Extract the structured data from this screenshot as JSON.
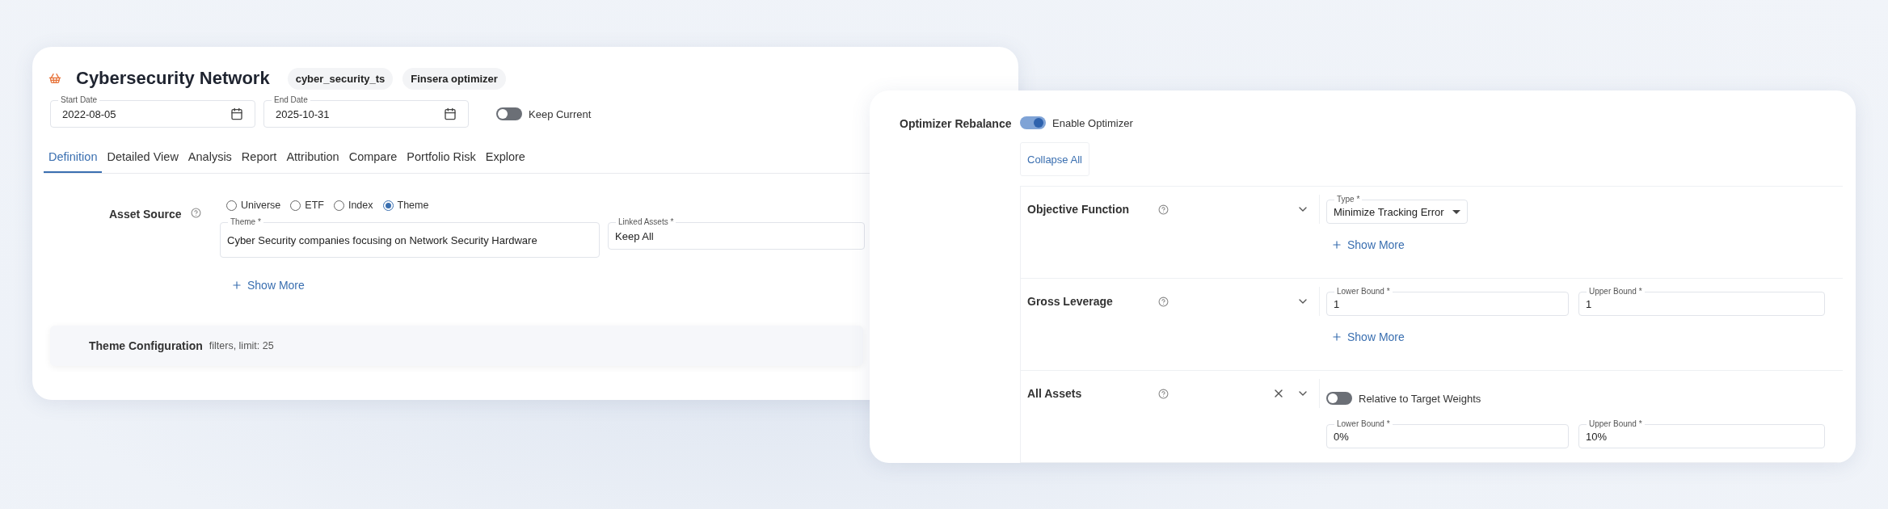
{
  "portfolio": {
    "title": "Cybersecurity Network",
    "tags": [
      "cyber_security_ts",
      "Finsera optimizer"
    ],
    "dates": [
      {
        "label": "Start Date",
        "value": "2022-08-05"
      },
      {
        "label": "End Date",
        "value": "2025-10-31"
      }
    ],
    "keep_current": {
      "label": "Keep Current",
      "on": false
    }
  },
  "tabs": [
    {
      "label": "Definition",
      "selected": true
    },
    {
      "label": "Detailed View",
      "selected": false
    },
    {
      "label": "Analysis",
      "selected": false
    },
    {
      "label": "Report",
      "selected": false
    },
    {
      "label": "Attribution",
      "selected": false
    },
    {
      "label": "Compare",
      "selected": false
    },
    {
      "label": "Portfolio Risk",
      "selected": false
    },
    {
      "label": "Explore",
      "selected": false
    }
  ],
  "asset_source": {
    "label": "Asset Source",
    "options": [
      {
        "label": "Universe",
        "selected": false
      },
      {
        "label": "ETF",
        "selected": false
      },
      {
        "label": "Index",
        "selected": false
      },
      {
        "label": "Theme",
        "selected": true
      }
    ],
    "theme_field": {
      "label": "Theme *",
      "value": "Cyber Security companies focusing on Network Security Hardware"
    },
    "linked_assets": {
      "label": "Linked Assets *",
      "value": "Keep All"
    },
    "show_more": "Show More"
  },
  "theme_configuration": {
    "title": "Theme Configuration",
    "summary": "filters, limit: 25"
  },
  "optimizer": {
    "label": "Optimizer Rebalance",
    "enable": {
      "label": "Enable Optimizer",
      "on": true
    },
    "collapse_all": "Collapse All",
    "sections": [
      {
        "title": "Objective Function",
        "removable": false,
        "items": [
          {
            "kind": "select",
            "label": "Type *",
            "value": "Minimize Tracking Error"
          },
          {
            "kind": "show_more",
            "label": "Show More"
          }
        ]
      },
      {
        "title": "Gross Leverage",
        "removable": false,
        "items": [
          {
            "kind": "bounds",
            "fields": [
              {
                "label": "Lower Bound *",
                "value": "1"
              },
              {
                "label": "Upper Bound *",
                "value": "1"
              }
            ]
          },
          {
            "kind": "show_more",
            "label": "Show More"
          }
        ]
      },
      {
        "title": "All Assets",
        "removable": true,
        "items": [
          {
            "kind": "toggle",
            "label": "Relative to Target Weights",
            "on": false
          },
          {
            "kind": "bounds",
            "fields": [
              {
                "label": "Lower Bound *",
                "value": "0%"
              },
              {
                "label": "Upper Bound *",
                "value": "10%"
              }
            ]
          }
        ]
      }
    ]
  }
}
